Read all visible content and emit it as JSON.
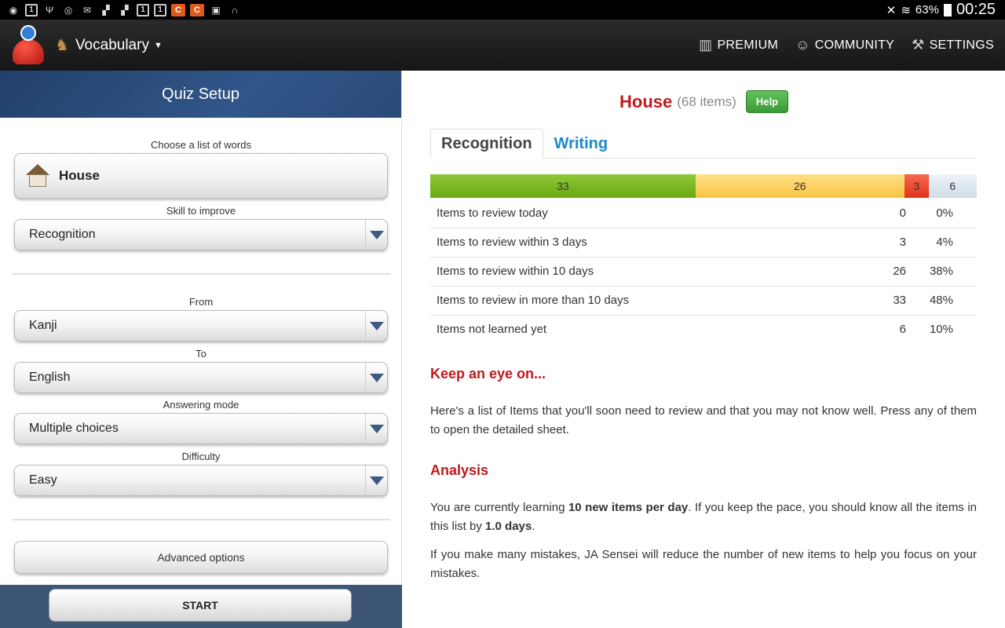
{
  "status_bar": {
    "left_icons": [
      "notification-icon",
      "screen-icon",
      "usb-icon",
      "sync-icon",
      "mail-icon",
      "flipboard-icon",
      "flipboard-icon",
      "calendar-icon",
      "calendar-icon",
      "c-icon",
      "c-icon",
      "bag-icon",
      "headset-icon"
    ],
    "battery": "63%",
    "time": "00:25"
  },
  "app_bar": {
    "title": "Vocabulary",
    "actions": [
      {
        "label": "PREMIUM",
        "icon": "barcode-icon"
      },
      {
        "label": "COMMUNITY",
        "icon": "community-icon"
      },
      {
        "label": "SETTINGS",
        "icon": "hammer-icon"
      }
    ]
  },
  "quiz_setup": {
    "header": "Quiz Setup",
    "list_label": "Choose a list of words",
    "list_value": "House",
    "skill_label": "Skill to improve",
    "skill_value": "Recognition",
    "from_label": "From",
    "from_value": "Kanji",
    "to_label": "To",
    "to_value": "English",
    "mode_label": "Answering mode",
    "mode_value": "Multiple choices",
    "difficulty_label": "Difficulty",
    "difficulty_value": "Easy",
    "advanced_label": "Advanced options",
    "start_label": "START"
  },
  "detail": {
    "title": "House",
    "count": "(68 items)",
    "help_label": "Help",
    "tabs": [
      "Recognition",
      "Writing"
    ],
    "bar": {
      "segments": [
        {
          "label": "33",
          "value": 33,
          "color": "#7ab828"
        },
        {
          "label": "26",
          "value": 26,
          "color": "#f9d060"
        },
        {
          "label": "3",
          "value": 3,
          "color": "#e8472c"
        },
        {
          "label": "6",
          "value": 6,
          "color": "#dfe8ef"
        }
      ]
    },
    "stats": [
      {
        "name": "Items to review today",
        "num": "0",
        "pct": "0%"
      },
      {
        "name": "Items to review within 3 days",
        "num": "3",
        "pct": "4%"
      },
      {
        "name": "Items to review within 10 days",
        "num": "26",
        "pct": "38%"
      },
      {
        "name": "Items to review in more than 10 days",
        "num": "33",
        "pct": "48%"
      },
      {
        "name": "Items not learned yet",
        "num": "6",
        "pct": "10%"
      }
    ],
    "keep_eye_title": "Keep an eye on...",
    "keep_eye_text": "Here's a list of Items that you'll soon need to review and that you may not know well. Press any of them to open the detailed sheet.",
    "analysis_title": "Analysis",
    "analysis_p1_a": "You are currently learning ",
    "analysis_p1_b": "10 new items per day",
    "analysis_p1_c": ". If you keep the pace, you should know all the items in this list by ",
    "analysis_p1_d": "1.0 days",
    "analysis_p1_e": ".",
    "analysis_p2": "If you make many mistakes, JA Sensei will reduce the number of new items to help you focus on your mistakes."
  }
}
